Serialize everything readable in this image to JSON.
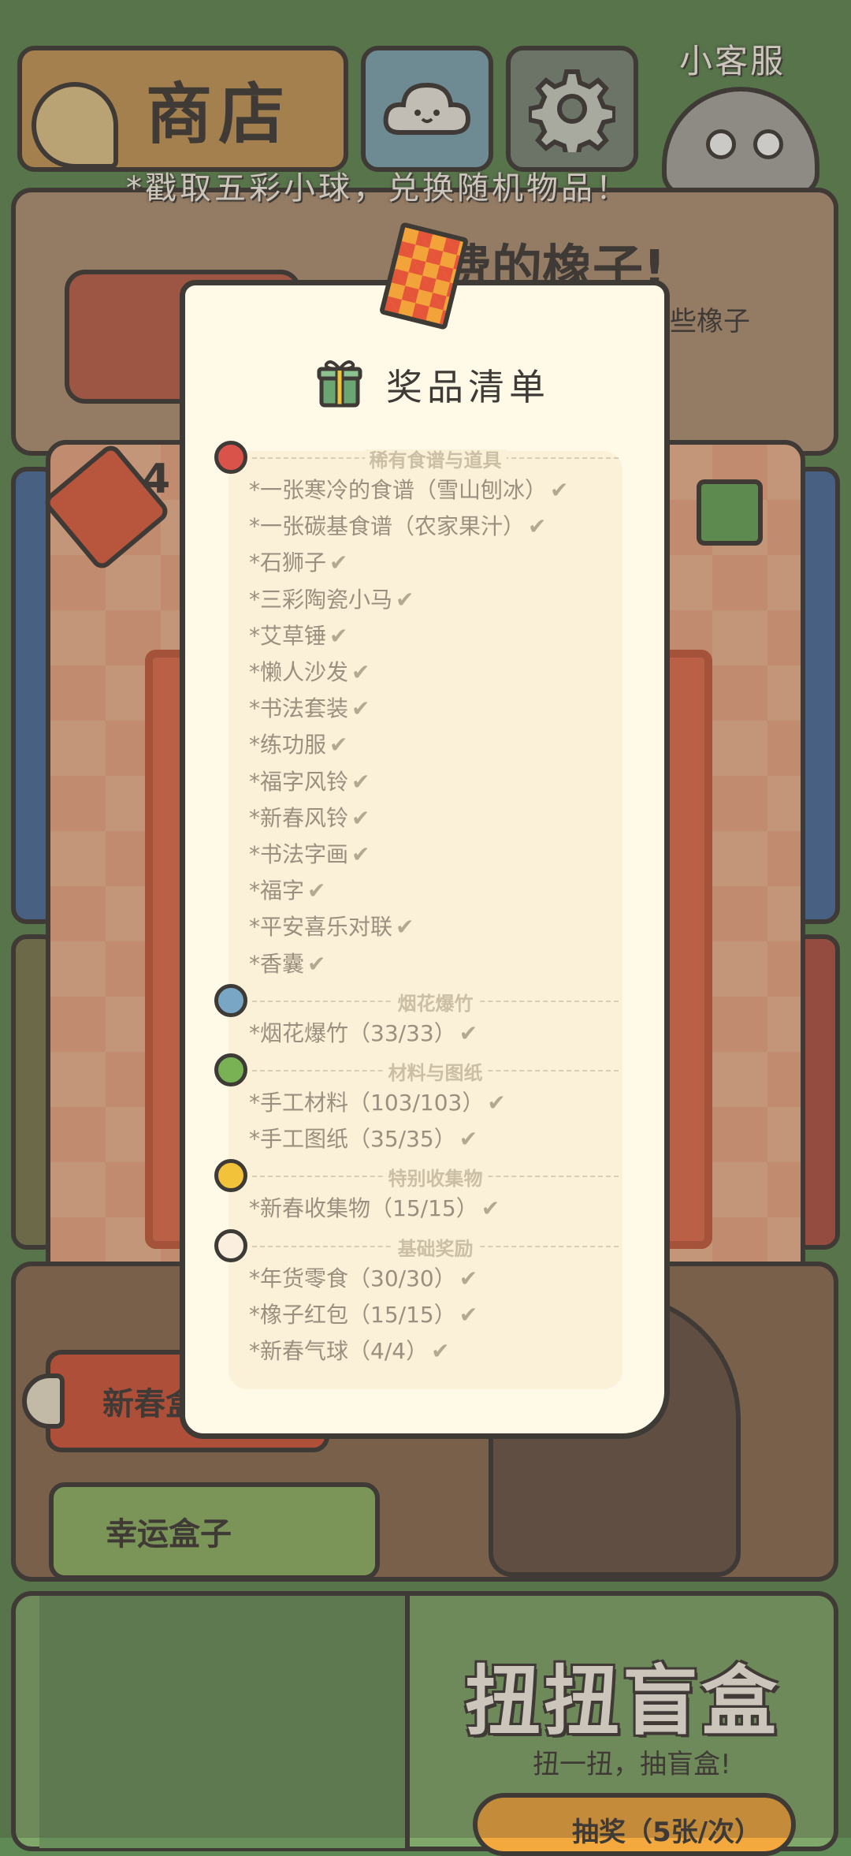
{
  "header": {
    "shop_label": "商店",
    "support_label": "小客服",
    "cloud_icon": "cloud-face-icon",
    "gear_icon": "gear-icon"
  },
  "notice": "*戳取五彩小球，兑换随机物品！",
  "free_acorn": {
    "title": "免费的橡子!",
    "subtitle": "些橡子"
  },
  "gacha_machine": {
    "ticket_count": "4",
    "ticket_icon": "ticket-icon",
    "mystery_gift_icon": "mystery-gift-icon"
  },
  "menu": {
    "spring_box": "新春盒",
    "lucky_box": "幸运盒子"
  },
  "bottom_panel": {
    "title": "扭扭盲盒",
    "subtitle": "扭一扭，抽盲盒!",
    "draw_button": "抽奖（5张/次）"
  },
  "prize_list": {
    "title": "奖品清单",
    "title_icon": "gift-icon",
    "sections": [
      {
        "name": "稀有食谱与道具",
        "color": "#d9534a",
        "items": [
          "*一张寒冷的食谱（雪山刨冰）",
          "*一张碳基食谱（农家果汁）",
          "*石狮子",
          "*三彩陶瓷小马",
          "*艾草锤",
          "*懒人沙发",
          "*书法套装",
          "*练功服",
          "*福字风铃",
          "*新春风铃",
          "*书法字画",
          "*福字",
          "*平安喜乐对联",
          "*香囊"
        ]
      },
      {
        "name": "烟花爆竹",
        "color": "#7aa6c6",
        "items": [
          "*烟花爆竹（33/33）"
        ]
      },
      {
        "name": "材料与图纸",
        "color": "#79b254",
        "items": [
          "*手工材料（103/103）",
          "*手工图纸（35/35）"
        ]
      },
      {
        "name": "特别收集物",
        "color": "#f2c33a",
        "items": [
          "*新春收集物（15/15）"
        ]
      },
      {
        "name": "基础奖励",
        "color": "#fbeede",
        "items": [
          "*年货零食（30/30）",
          "*橡子红包（15/15）",
          "*新春气球（4/4）"
        ]
      }
    ]
  }
}
